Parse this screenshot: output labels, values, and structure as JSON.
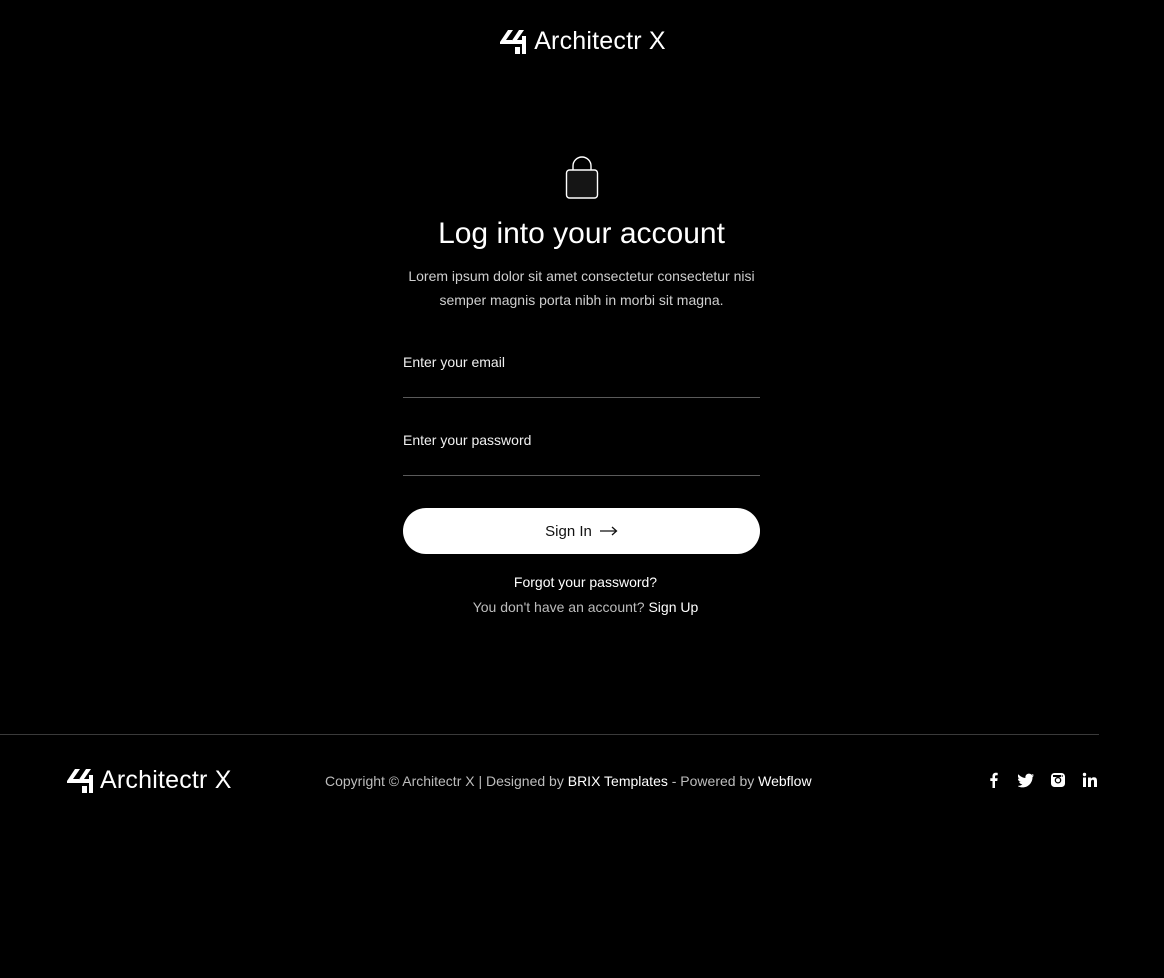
{
  "brand": {
    "name": "Architectr X"
  },
  "login": {
    "title": "Log into your account",
    "subtitle": "Lorem ipsum dolor sit amet consectetur consectetur nisi semper magnis porta nibh in morbi sit magna.",
    "email_placeholder": "Enter your email",
    "password_placeholder": "Enter your password",
    "signin_label": "Sign In",
    "forgot_label": "Forgot your password?",
    "no_account_text": "You don't have an account?",
    "signup_label": "Sign Up"
  },
  "footer": {
    "copyright_prefix": "Copyright © Architectr X | Designed by ",
    "designer": "BRIX Templates",
    "powered_prefix": " - Powered by ",
    "platform": "Webflow",
    "social_icons": [
      "facebook-icon",
      "twitter-icon",
      "instagram-icon",
      "linkedin-icon"
    ]
  },
  "colors": {
    "background": "#000000",
    "text": "#ffffff",
    "muted_text": "#bdbdbd",
    "divider": "#3a3a3a",
    "button_bg": "#ffffff"
  }
}
